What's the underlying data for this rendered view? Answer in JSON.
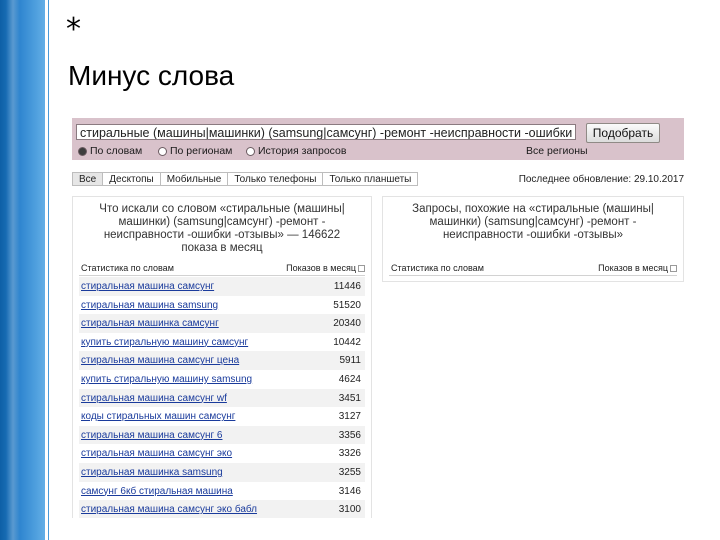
{
  "slide": {
    "asterisk": "*",
    "title": "Минус слова"
  },
  "search": {
    "query": "стиральные (машины|машинки) (samsung|самсунг) -ремонт -неисправности -ошибки -с",
    "button_label": "Подобрать"
  },
  "modes": [
    {
      "label": "По словам",
      "selected": true
    },
    {
      "label": "По регионам",
      "selected": false
    },
    {
      "label": "История запросов",
      "selected": false
    }
  ],
  "region": {
    "label": "Все регионы"
  },
  "tabs": [
    "Все",
    "Десктопы",
    "Мобильные",
    "Только телефоны",
    "Только планшеты"
  ],
  "updated": "Последнее обновление: 29.10.2017",
  "left_panel": {
    "title_lines": [
      "Что искали со словом «стиральные (машины|",
      "машинки) (samsung|самсунг) -ремонт -",
      "неисправности -ошибки -отзывы» — 146622",
      "показа в месяц"
    ],
    "col_phrase": "Статистика по словам",
    "col_count": "Показов в месяц",
    "rows": [
      {
        "phrase": "стиральная машина самсунг",
        "count": "11446"
      },
      {
        "phrase": "стиральная машина samsung",
        "count": "51520"
      },
      {
        "phrase": "стиральная машинка самсунг",
        "count": "20340"
      },
      {
        "phrase": "купить стиральную машину самсунг",
        "count": "10442"
      },
      {
        "phrase": "стиральная машина самсунг цена",
        "count": "5911"
      },
      {
        "phrase": "купить стиральную машину samsung",
        "count": "4624"
      },
      {
        "phrase": "стиральная машина самсунг wf",
        "count": "3451"
      },
      {
        "phrase": "коды стиральных машин самсунг",
        "count": "3127"
      },
      {
        "phrase": "стиральная машина самсунг 6",
        "count": "3356"
      },
      {
        "phrase": "стиральная машина самсунг эко",
        "count": "3326"
      },
      {
        "phrase": "стиральная машинка samsung",
        "count": "3255"
      },
      {
        "phrase": "самсунг 6кб стиральная машина",
        "count": "3146"
      },
      {
        "phrase": "стиральная машина самсунг эко бабл",
        "count": "3100"
      }
    ]
  },
  "right_panel": {
    "title_lines": [
      "Запросы, похожие на «стиральные (машины|",
      "машинки) (samsung|самсунг) -ремонт -",
      "неисправности -ошибки -отзывы»"
    ],
    "col_phrase": "Статистика по словам",
    "col_count": "Показов в месяц"
  },
  "colors": {
    "topbar": "#d9c2cb",
    "link": "#1a3b9c",
    "accent_band": "#2f86d0"
  }
}
